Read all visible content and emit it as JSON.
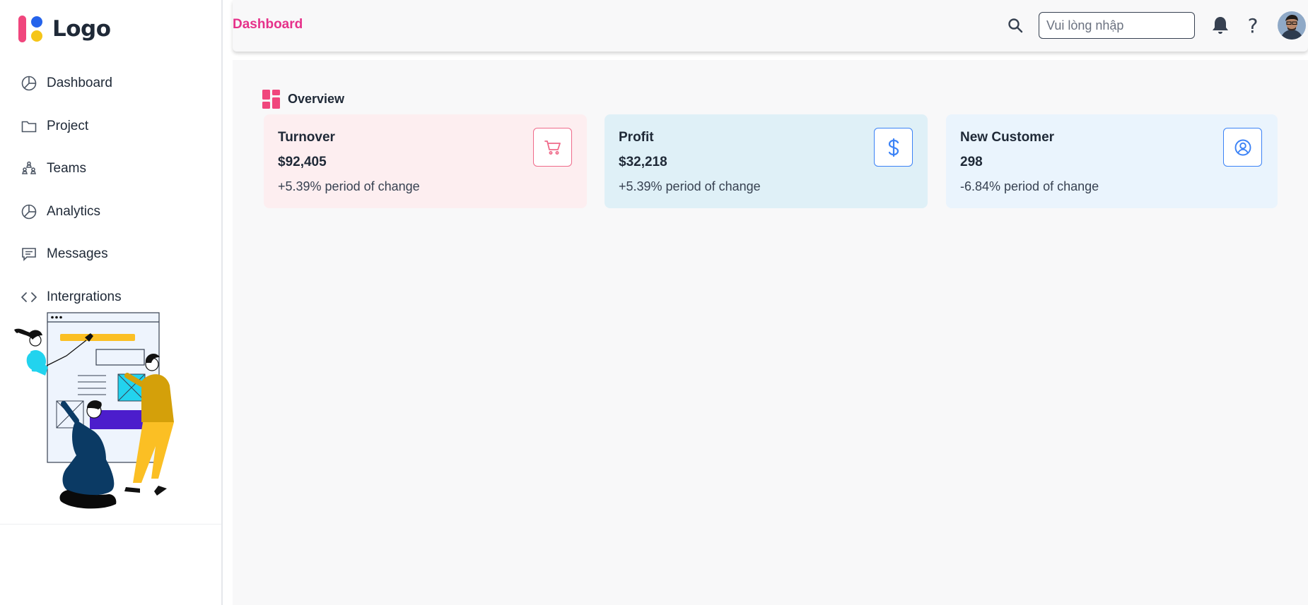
{
  "app": {
    "logo_text": "Logo"
  },
  "sidebar": {
    "items": [
      {
        "label": "Dashboard",
        "icon": "pie-chart-icon"
      },
      {
        "label": "Project",
        "icon": "folder-icon"
      },
      {
        "label": "Teams",
        "icon": "team-icon"
      },
      {
        "label": "Analytics",
        "icon": "pie-chart-icon"
      },
      {
        "label": "Messages",
        "icon": "message-icon"
      },
      {
        "label": "Intergrations",
        "icon": "code-icon"
      }
    ]
  },
  "header": {
    "breadcrumb": "Dashboard",
    "search_placeholder": "Vui lòng nhập",
    "help_label": "?"
  },
  "overview": {
    "title": "Overview",
    "cards": [
      {
        "title": "Turnover",
        "value": "$92,405",
        "change": "+5.39% period of change",
        "icon": "cart-icon",
        "bg": "#fdeef0",
        "accent": "#ef6a8a"
      },
      {
        "title": "Profit",
        "value": "$32,218",
        "change": "+5.39% period of change",
        "icon": "dollar-icon",
        "bg": "#dff0f7",
        "accent": "#3b82f6"
      },
      {
        "title": "New Customer",
        "value": "298",
        "change": "-6.84% period of change",
        "icon": "user-circle-icon",
        "bg": "#eaf4fd",
        "accent": "#3b82f6"
      }
    ]
  },
  "colors": {
    "brand_pink": "#e6318a",
    "logo_blue": "#2563eb",
    "logo_yellow": "#f5c518",
    "logo_pink": "#f0467d"
  }
}
